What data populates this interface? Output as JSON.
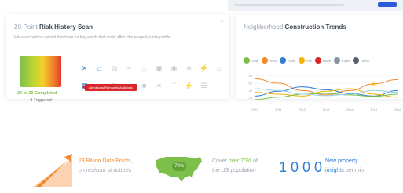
{
  "risk_card": {
    "title_prefix": "20-Point",
    "title_bold": "Risk History Scan",
    "subtitle": "We searched our permit database for key words that could affect the property's risk profile.",
    "completed": "20 of 20 Completed",
    "triggered_count": "4",
    "triggered_label": "Triggered",
    "tooltip": "Alterations/Remodels/Additions",
    "icon_rows": [
      [
        "wrench-icon",
        "roof-icon",
        "bath-icon",
        "water-icon",
        "fire-icon",
        "paint-icon",
        "pool-icon",
        "hvac-icon",
        "electric-icon",
        "house-icon"
      ],
      [
        "building-icon",
        "window-icon",
        "demolition-icon",
        "grading-icon",
        "foundation-icon",
        "solar-icon",
        "plumbing-icon",
        "bolt-icon",
        "permit-icon",
        "misc-icon"
      ]
    ],
    "active_icons": [
      "wrench-icon",
      "roof-icon",
      "building-icon"
    ]
  },
  "trend_card": {
    "title_prefix": "Neighborhood",
    "title_bold": "Construction Trends",
    "legend": [
      {
        "label": "Solar",
        "color": "#7cc04b"
      },
      {
        "label": "Roof",
        "color": "#f08a2c"
      },
      {
        "label": "Pools",
        "color": "#2f7fd6"
      },
      {
        "label": "Fire",
        "color": "#f4b400"
      },
      {
        "label": "Alarm",
        "color": "#d9262b"
      },
      {
        "label": "Pipes",
        "color": "#8a939c"
      },
      {
        "label": "Demo",
        "color": "#555f69"
      }
    ]
  },
  "chart_data": {
    "type": "line",
    "title": "",
    "xlabel": "",
    "ylabel": "",
    "x": [
      "2010",
      "2011",
      "2012",
      "2013",
      "2014",
      "2015",
      "2016"
    ],
    "yticks": [
      "80",
      "60",
      "40",
      "20"
    ],
    "ylim": [
      0,
      90
    ],
    "grid": true,
    "series": [
      {
        "name": "Roof",
        "color": "#f08a2c",
        "values": [
          72,
          60,
          40,
          28,
          40,
          58,
          70
        ]
      },
      {
        "name": "Pools",
        "color": "#2f7fd6",
        "values": [
          25,
          38,
          50,
          42,
          32,
          25,
          40
        ]
      },
      {
        "name": "Fire",
        "color": "#f4b400",
        "values": [
          35,
          30,
          25,
          38,
          45,
          30,
          22
        ]
      },
      {
        "name": "Solar",
        "color": "#7cc04b",
        "values": [
          15,
          22,
          30,
          32,
          28,
          24,
          30
        ]
      },
      {
        "name": "Alarm",
        "color": "#9ad1ee",
        "values": [
          45,
          40,
          30,
          26,
          30,
          40,
          35
        ]
      }
    ],
    "marker": {
      "x": "2015",
      "y": 58,
      "color": "#f4b400"
    }
  },
  "stats": [
    {
      "highlight": "23 Billion Data Points,",
      "rest": "on res/com structures"
    },
    {
      "badge": "70%",
      "line1_a": "Cover ",
      "line1_hl": "over 70%",
      "line1_b": " of",
      "line2": "the US population"
    },
    {
      "number": "1000",
      "hl": "New property",
      "line2_hl": "insights",
      "line2_rest": " per min"
    }
  ]
}
